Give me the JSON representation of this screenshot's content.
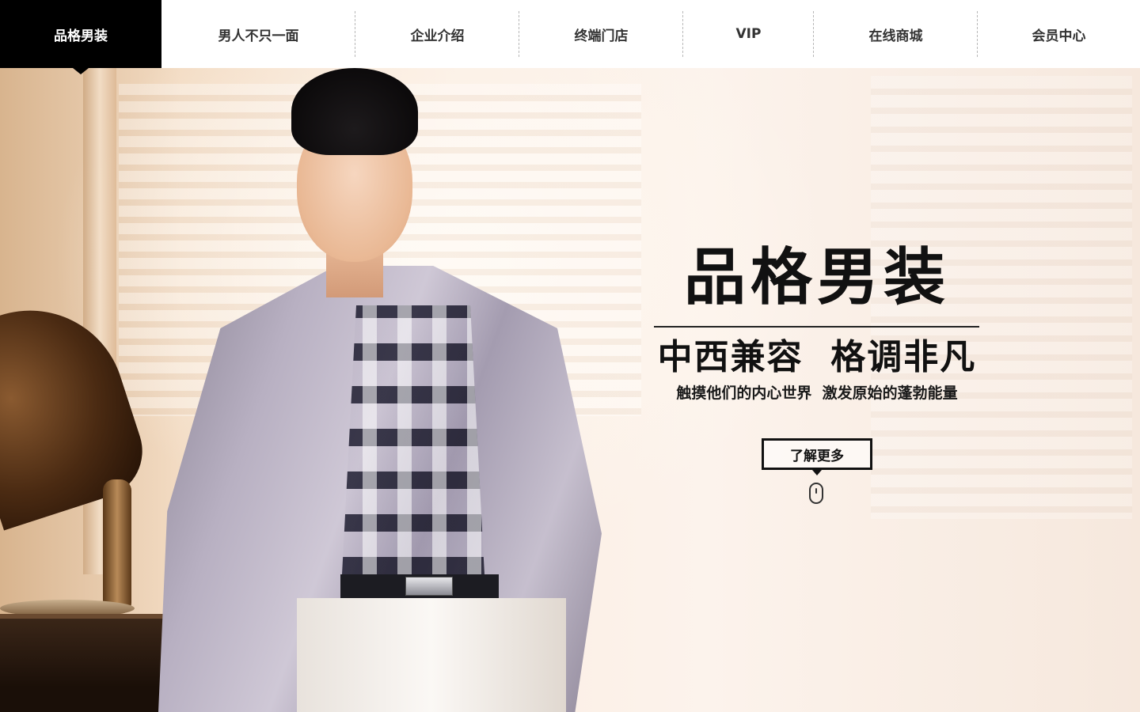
{
  "nav": {
    "logo": "品格男装",
    "items": [
      {
        "label": "男人不只一面"
      },
      {
        "label": "企业介绍"
      },
      {
        "label": "终端门店"
      },
      {
        "label": "VIP"
      },
      {
        "label": "在线商城"
      },
      {
        "label": "会员中心"
      }
    ]
  },
  "hero": {
    "title": "品格男装",
    "subtitle": "中西兼容  格调非凡",
    "tagline": "触摸他们的内心世界  激发原始的蓬勃能量",
    "cta_label": "了解更多"
  },
  "colors": {
    "nav_active_bg": "#000000",
    "nav_bg": "#ffffff",
    "nav_text": "#333333",
    "hero_text": "#111111"
  },
  "icons": [
    "mouse-scroll-icon"
  ]
}
